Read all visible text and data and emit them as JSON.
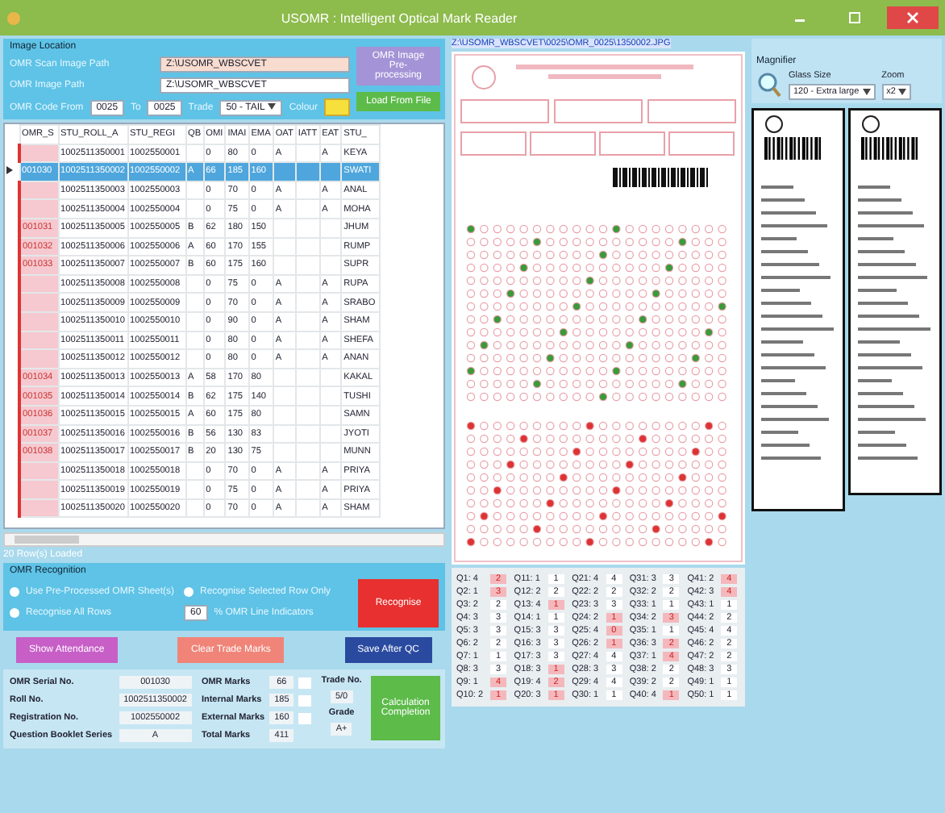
{
  "window": {
    "title": "USOMR : Intelligent Optical Mark Reader"
  },
  "image_location": {
    "title": "Image Location",
    "scan_path_label": "OMR Scan Image Path",
    "scan_path": "Z:\\USOMR_WBSCVET",
    "image_path_label": "OMR Image Path",
    "image_path": "Z:\\USOMR_WBSCVET",
    "code_from_label": "OMR Code From",
    "code_from": "0025",
    "code_to_label": "To",
    "code_to": "0025",
    "trade_label": "Trade",
    "trade": "50 - TAIL",
    "colour_label": "Colour",
    "preprocess_button": "OMR Image Pre-processing",
    "load_button": "Load From File"
  },
  "table": {
    "columns": [
      "OMR_S",
      "STU_ROLL_A",
      "STU_REGI",
      "QB",
      "OMI",
      "IMAI",
      "EMA",
      "OAT",
      "IATT",
      "EAT",
      "STU_"
    ],
    "rows": [
      {
        "selected": false,
        "cells": [
          "",
          "1002511350001",
          "1002550001",
          "",
          "0",
          "80",
          "0",
          "A",
          "",
          "A",
          "KEYA"
        ]
      },
      {
        "selected": true,
        "cells": [
          "001030",
          "1002511350002",
          "1002550002",
          "A",
          "66",
          "185",
          "160",
          "",
          "",
          "",
          "SWATI"
        ]
      },
      {
        "selected": false,
        "cells": [
          "",
          "1002511350003",
          "1002550003",
          "",
          "0",
          "70",
          "0",
          "A",
          "",
          "A",
          "ANAL"
        ]
      },
      {
        "selected": false,
        "cells": [
          "",
          "1002511350004",
          "1002550004",
          "",
          "0",
          "75",
          "0",
          "A",
          "",
          "A",
          "MOHA"
        ]
      },
      {
        "selected": false,
        "cells": [
          "001031",
          "1002511350005",
          "1002550005",
          "B",
          "62",
          "180",
          "150",
          "",
          "",
          "",
          "JHUM"
        ]
      },
      {
        "selected": false,
        "cells": [
          "001032",
          "1002511350006",
          "1002550006",
          "A",
          "60",
          "170",
          "155",
          "",
          "",
          "",
          "RUMP"
        ]
      },
      {
        "selected": false,
        "cells": [
          "001033",
          "1002511350007",
          "1002550007",
          "B",
          "60",
          "175",
          "160",
          "",
          "",
          "",
          "SUPR"
        ]
      },
      {
        "selected": false,
        "cells": [
          "",
          "1002511350008",
          "1002550008",
          "",
          "0",
          "75",
          "0",
          "A",
          "",
          "A",
          "RUPA"
        ]
      },
      {
        "selected": false,
        "cells": [
          "",
          "1002511350009",
          "1002550009",
          "",
          "0",
          "70",
          "0",
          "A",
          "",
          "A",
          "SRABO"
        ]
      },
      {
        "selected": false,
        "cells": [
          "",
          "1002511350010",
          "1002550010",
          "",
          "0",
          "90",
          "0",
          "A",
          "",
          "A",
          "SHAM"
        ]
      },
      {
        "selected": false,
        "cells": [
          "",
          "1002511350011",
          "1002550011",
          "",
          "0",
          "80",
          "0",
          "A",
          "",
          "A",
          "SHEFA"
        ]
      },
      {
        "selected": false,
        "cells": [
          "",
          "1002511350012",
          "1002550012",
          "",
          "0",
          "80",
          "0",
          "A",
          "",
          "A",
          "ANAN"
        ]
      },
      {
        "selected": false,
        "cells": [
          "001034",
          "1002511350013",
          "1002550013",
          "A",
          "58",
          "170",
          "80",
          "",
          "",
          "",
          "KAKAL"
        ]
      },
      {
        "selected": false,
        "cells": [
          "001035",
          "1002511350014",
          "1002550014",
          "B",
          "62",
          "175",
          "140",
          "",
          "",
          "",
          "TUSHI"
        ]
      },
      {
        "selected": false,
        "cells": [
          "001036",
          "1002511350015",
          "1002550015",
          "A",
          "60",
          "175",
          "80",
          "",
          "",
          "",
          "SAMN"
        ]
      },
      {
        "selected": false,
        "cells": [
          "001037",
          "1002511350016",
          "1002550016",
          "B",
          "56",
          "130",
          "83",
          "",
          "",
          "",
          "JYOTI"
        ]
      },
      {
        "selected": false,
        "cells": [
          "001038",
          "1002511350017",
          "1002550017",
          "B",
          "20",
          "130",
          "75",
          "",
          "",
          "",
          "MUNN"
        ]
      },
      {
        "selected": false,
        "cells": [
          "",
          "1002511350018",
          "1002550018",
          "",
          "0",
          "70",
          "0",
          "A",
          "",
          "A",
          "PRIYA"
        ]
      },
      {
        "selected": false,
        "cells": [
          "",
          "1002511350019",
          "1002550019",
          "",
          "0",
          "75",
          "0",
          "A",
          "",
          "A",
          "PRIYA"
        ]
      },
      {
        "selected": false,
        "cells": [
          "",
          "1002511350020",
          "1002550020",
          "",
          "0",
          "70",
          "0",
          "A",
          "",
          "A",
          "SHAM"
        ]
      }
    ]
  },
  "status": "20 Row(s) Loaded",
  "recognition": {
    "title": "OMR Recognition",
    "options": [
      {
        "label": "Use Pre-Processed OMR Sheet(s)",
        "checked": false
      },
      {
        "label": "Recognise Selected Row Only",
        "checked": false
      },
      {
        "label": "Recognise All Rows",
        "checked": false
      }
    ],
    "threshold": "60",
    "threshold_label": "% OMR Line Indicators",
    "recognise_button": "Recognise"
  },
  "actions": [
    "Show Attendance",
    "Clear Trade Marks",
    "Save After QC"
  ],
  "result": {
    "fields": [
      {
        "label": "OMR Serial No.",
        "value": "001030"
      },
      {
        "label": "Roll No.",
        "value": "1002511350002"
      },
      {
        "label": "Registration No.",
        "value": "1002550002"
      },
      {
        "label": "Question Booklet Series",
        "value": "A"
      }
    ],
    "marks": [
      {
        "label": "OMR Marks",
        "value": "66"
      },
      {
        "label": "Internal Marks",
        "value": "185"
      },
      {
        "label": "External Marks",
        "value": "160"
      },
      {
        "label": "Total Marks",
        "value": "411"
      }
    ],
    "trade_no_label": "Trade No.",
    "trade_no": "5/0",
    "grade_label": "Grade",
    "grade": "A+",
    "complete_button": "Calculation Completion"
  },
  "sheet": {
    "path": "Z:\\USOMR_WBSCVET\\0025\\OMR_0025\\1350002.JPG"
  },
  "answers": [
    {
      "q": "Q1: 4",
      "a": "2",
      "mismatch": true
    },
    {
      "q": "Q2: 1",
      "a": "3",
      "mismatch": true
    },
    {
      "q": "Q3: 2",
      "a": "2",
      "mismatch": false
    },
    {
      "q": "Q4: 3",
      "a": "3",
      "mismatch": false
    },
    {
      "q": "Q5: 3",
      "a": "3",
      "mismatch": false
    },
    {
      "q": "Q6: 2",
      "a": "2",
      "mismatch": false
    },
    {
      "q": "Q7: 1",
      "a": "1",
      "mismatch": false
    },
    {
      "q": "Q8: 3",
      "a": "3",
      "mismatch": false
    },
    {
      "q": "Q9: 1",
      "a": "4",
      "mismatch": true
    },
    {
      "q": "Q10: 2",
      "a": "1",
      "mismatch": true
    },
    {
      "q": "Q11: 1",
      "a": "1",
      "mismatch": false
    },
    {
      "q": "Q12: 2",
      "a": "2",
      "mismatch": false
    },
    {
      "q": "Q13: 4",
      "a": "1",
      "mismatch": true
    },
    {
      "q": "Q14: 1",
      "a": "1",
      "mismatch": false
    },
    {
      "q": "Q15: 3",
      "a": "3",
      "mismatch": false
    },
    {
      "q": "Q16: 3",
      "a": "3",
      "mismatch": false
    },
    {
      "q": "Q17: 3",
      "a": "3",
      "mismatch": false
    },
    {
      "q": "Q18: 3",
      "a": "1",
      "mismatch": true
    },
    {
      "q": "Q19: 4",
      "a": "2",
      "mismatch": true
    },
    {
      "q": "Q20: 3",
      "a": "1",
      "mismatch": true
    },
    {
      "q": "Q21: 4",
      "a": "4",
      "mismatch": false
    },
    {
      "q": "Q22: 2",
      "a": "2",
      "mismatch": false
    },
    {
      "q": "Q23: 3",
      "a": "3",
      "mismatch": false
    },
    {
      "q": "Q24: 2",
      "a": "1",
      "mismatch": true
    },
    {
      "q": "Q25: 4",
      "a": "0",
      "mismatch": true
    },
    {
      "q": "Q26: 2",
      "a": "1",
      "mismatch": true
    },
    {
      "q": "Q27: 4",
      "a": "4",
      "mismatch": false
    },
    {
      "q": "Q28: 3",
      "a": "3",
      "mismatch": false
    },
    {
      "q": "Q29: 4",
      "a": "4",
      "mismatch": false
    },
    {
      "q": "Q30: 1",
      "a": "1",
      "mismatch": false
    },
    {
      "q": "Q31: 3",
      "a": "3",
      "mismatch": false
    },
    {
      "q": "Q32: 2",
      "a": "2",
      "mismatch": false
    },
    {
      "q": "Q33: 1",
      "a": "1",
      "mismatch": false
    },
    {
      "q": "Q34: 2",
      "a": "3",
      "mismatch": true
    },
    {
      "q": "Q35: 1",
      "a": "1",
      "mismatch": false
    },
    {
      "q": "Q36: 3",
      "a": "2",
      "mismatch": true
    },
    {
      "q": "Q37: 1",
      "a": "4",
      "mismatch": true
    },
    {
      "q": "Q38: 2",
      "a": "2",
      "mismatch": false
    },
    {
      "q": "Q39: 2",
      "a": "2",
      "mismatch": false
    },
    {
      "q": "Q40: 4",
      "a": "1",
      "mismatch": true
    },
    {
      "q": "Q41: 2",
      "a": "4",
      "mismatch": true
    },
    {
      "q": "Q42: 3",
      "a": "4",
      "mismatch": true
    },
    {
      "q": "Q43: 1",
      "a": "1",
      "mismatch": false
    },
    {
      "q": "Q44: 2",
      "a": "2",
      "mismatch": false
    },
    {
      "q": "Q45: 4",
      "a": "4",
      "mismatch": false
    },
    {
      "q": "Q46: 2",
      "a": "2",
      "mismatch": false
    },
    {
      "q": "Q47: 2",
      "a": "2",
      "mismatch": false
    },
    {
      "q": "Q48: 3",
      "a": "3",
      "mismatch": false
    },
    {
      "q": "Q49: 1",
      "a": "1",
      "mismatch": false
    },
    {
      "q": "Q50: 1",
      "a": "1",
      "mismatch": false
    }
  ],
  "magnifier": {
    "title": "Magnifier",
    "glass_size_label": "Glass Size",
    "glass_size": "120 - Extra large",
    "zoom_label": "Zoom",
    "zoom": "x2"
  }
}
